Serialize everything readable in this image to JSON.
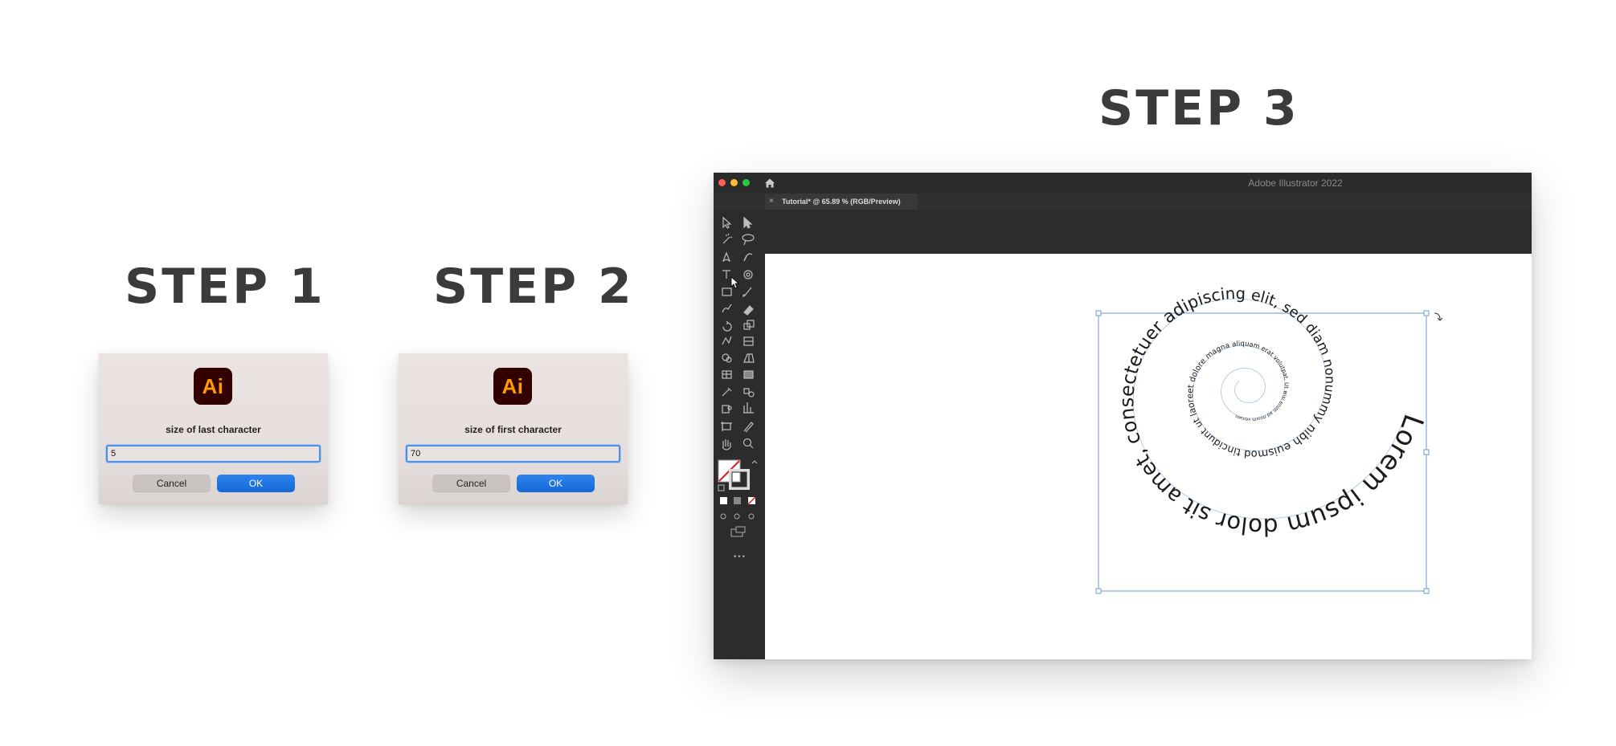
{
  "steps": {
    "step1": "STEP 1",
    "step2": "STEP 2",
    "step3": "STEP 3"
  },
  "dialog1": {
    "logo": "Ai",
    "prompt": "size of last character",
    "value": "5",
    "cancel_label": "Cancel",
    "ok_label": "OK"
  },
  "dialog2": {
    "logo": "Ai",
    "prompt": "size of first character",
    "value": "70",
    "cancel_label": "Cancel",
    "ok_label": "OK"
  },
  "illustrator": {
    "window_title": "Adobe Illustrator 2022",
    "tab_label": "Tutorial* @ 65.89 % (RGB/Preview)",
    "tab_close": "×",
    "more_tools": "•••",
    "spiral_text": "Lorem ipsum dolor sit amet, consectetuer adipiscing elit, sed diam nonummy nibh euismod tincidunt ut laoreet dolore magna aliquam erat volutpat. Ut wisi enim ad minim veniam"
  },
  "colors": {
    "accent_blue": "#1569d8",
    "ai_logo_bg": "#330000",
    "ai_logo_fg": "#ff9a00",
    "selection_blue": "#6d95d6",
    "toolbar_bg": "#2c2c2c"
  },
  "icons": [
    "selection-tool-icon",
    "direct-selection-tool-icon",
    "magic-wand-icon",
    "lasso-icon",
    "pen-tool-icon",
    "curvature-tool-icon",
    "type-tool-icon",
    "spiral-tool-icon",
    "rectangle-tool-icon",
    "paintbrush-icon",
    "shaper-tool-icon",
    "eraser-icon",
    "rotate-tool-icon",
    "scale-tool-icon",
    "puppet-warp-icon",
    "width-tool-icon",
    "shape-builder-icon",
    "perspective-grid-icon",
    "mesh-tool-icon",
    "gradient-tool-icon",
    "eyedropper-icon",
    "blend-tool-icon",
    "symbol-sprayer-icon",
    "graph-tool-icon",
    "artboard-tool-icon",
    "slice-tool-icon",
    "hand-tool-icon",
    "zoom-tool-icon",
    "home-icon",
    "close-icon"
  ]
}
